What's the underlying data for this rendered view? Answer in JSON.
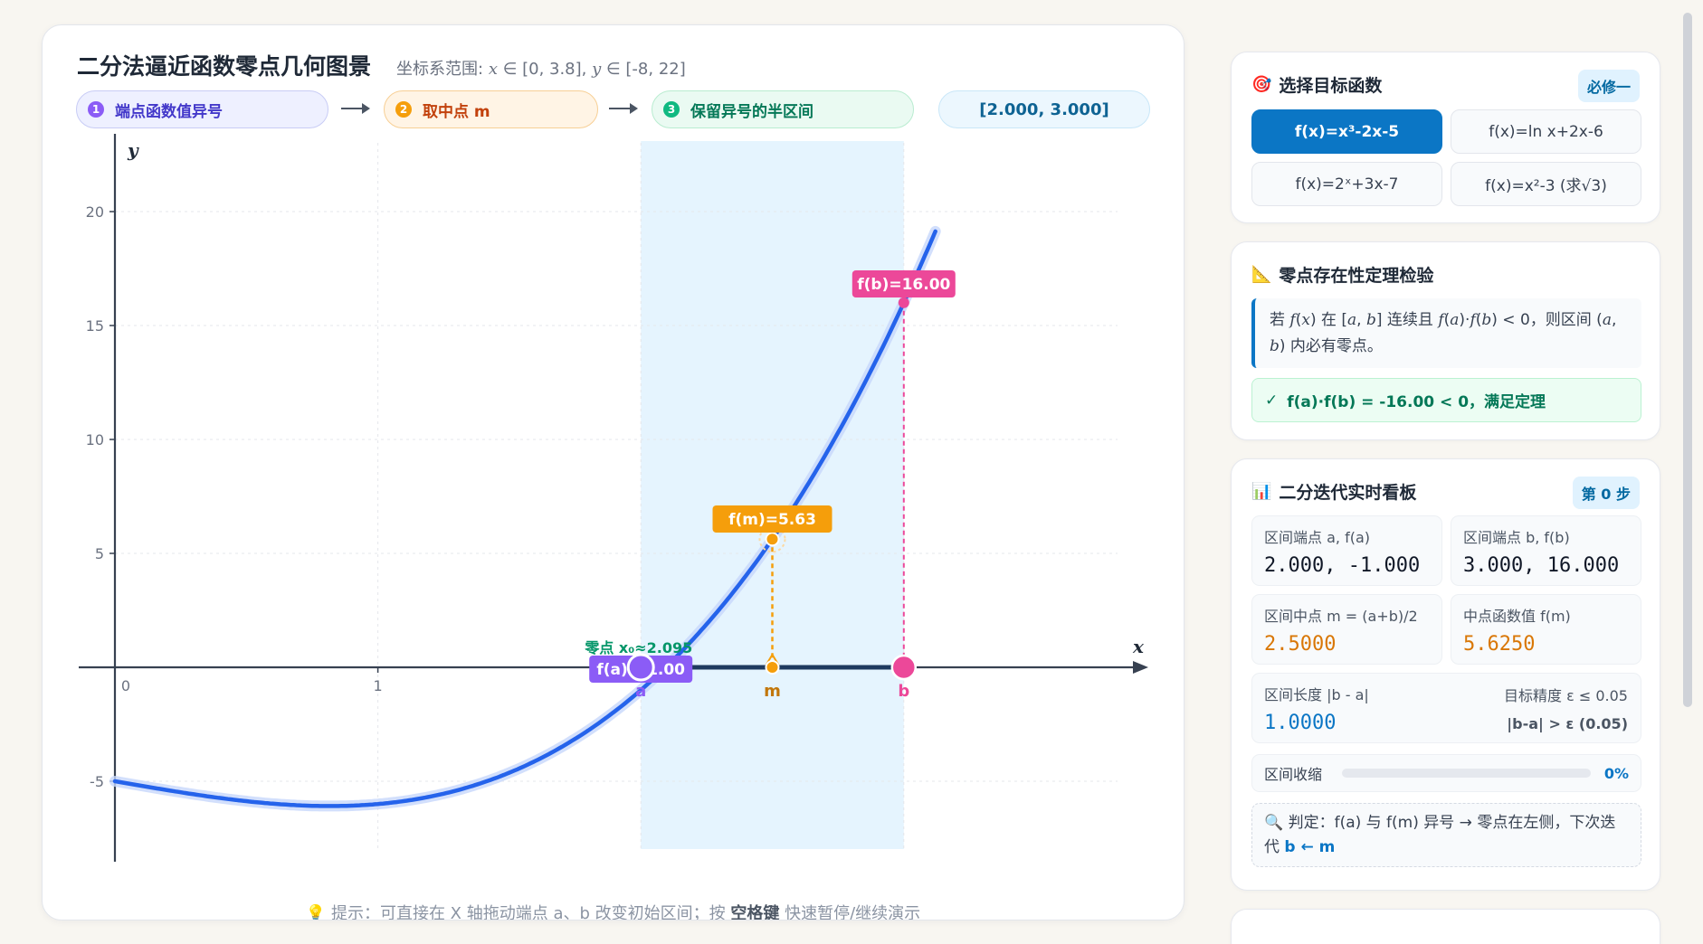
{
  "main": {
    "title": "二分法逼近函数零点几何图景",
    "range_prefix": "坐标系范围: ",
    "range_x": "x",
    "range_x_val": " ∈ [0, 3.8], ",
    "range_y": "y",
    "range_y_val": " ∈ [-8, 22]",
    "steps": [
      {
        "num": "1",
        "label": "端点函数值异号"
      },
      {
        "num": "2",
        "label": "取中点 m"
      },
      {
        "num": "3",
        "label": "保留异号的半区间"
      }
    ],
    "interval": "[2.000, 3.000]",
    "hint_prefix": "💡 提示：可直接在 X 轴拖动端点 a、b 改变初始区间；按 ",
    "hint_key": "空格键",
    "hint_suffix": " 快速暂停/继续演示"
  },
  "chart_data": {
    "type": "line",
    "function": "f(x)=x³-2x-5",
    "xlim": [
      0,
      3.8
    ],
    "ylim": [
      -8,
      22
    ],
    "x_ticks": [
      0,
      1,
      2,
      3
    ],
    "x_tick_labels": [
      "0",
      "1",
      "",
      ""
    ],
    "y_ticks": [
      -5,
      5,
      10,
      15,
      20
    ],
    "y_tick_labels": [
      "-5",
      "5",
      "10",
      "15",
      "20"
    ],
    "xlabel": "x",
    "ylabel": "y",
    "grid": true,
    "a": 2.0,
    "b": 3.0,
    "m": 2.5,
    "fa": -1.0,
    "fb": 16.0,
    "fm": 5.625,
    "root": 2.095,
    "labels": {
      "fa": "f(a)=-1.00",
      "fb": "f(b)=16.00",
      "fm": "f(m)=5.63",
      "root": "零点 x₀≈2.095",
      "a": "a",
      "b": "b",
      "m": "m"
    },
    "colors": {
      "curve": "#2563eb",
      "interval": "#e0f2fe",
      "a": "#8b5cf6",
      "b": "#ec4899",
      "m": "#f59e0b",
      "root": "#059669"
    }
  },
  "sidebar": {
    "func_card": {
      "icon": "🎯",
      "title": "选择目标函数",
      "badge": "必修一",
      "options": [
        "f(x)=x³-2x-5",
        "f(x)=ln x+2x-6",
        "f(x)=2ˣ+3x-7",
        "f(x)=x²-3 (求√3)"
      ]
    },
    "theorem_card": {
      "icon": "📐",
      "title": "零点存在性定理检验",
      "check_icon": "✓",
      "check_text": "f(a)·f(b) = -16.00 < 0，满足定理"
    },
    "iter_card": {
      "icon": "📊",
      "title": "二分迭代实时看板",
      "badge": "第 0 步",
      "stats": [
        {
          "label": "区间端点 a, f(a)",
          "value": "2.000, -1.000"
        },
        {
          "label": "区间端点 b, f(b)",
          "value": "3.000, 16.000"
        },
        {
          "label": "区间中点 m = (a+b)/2",
          "value": "2.5000"
        },
        {
          "label": "中点函数值 f(m)",
          "value": "5.6250"
        }
      ],
      "length_label": "区间长度 |b - a|",
      "length_value": "1.0000",
      "eps_label": "目标精度 ε ≤ 0.05",
      "eps_note": "|b-a| > ε (0.05)",
      "progress_label": "区间收缩",
      "progress_pct": "0%",
      "progress_value": 0,
      "judge_icon": "🔍",
      "judge_text": "判定：f(a) 与 f(m) 异号 → 零点在左侧，下次迭代 ",
      "judge_bold": "b ← m"
    }
  }
}
